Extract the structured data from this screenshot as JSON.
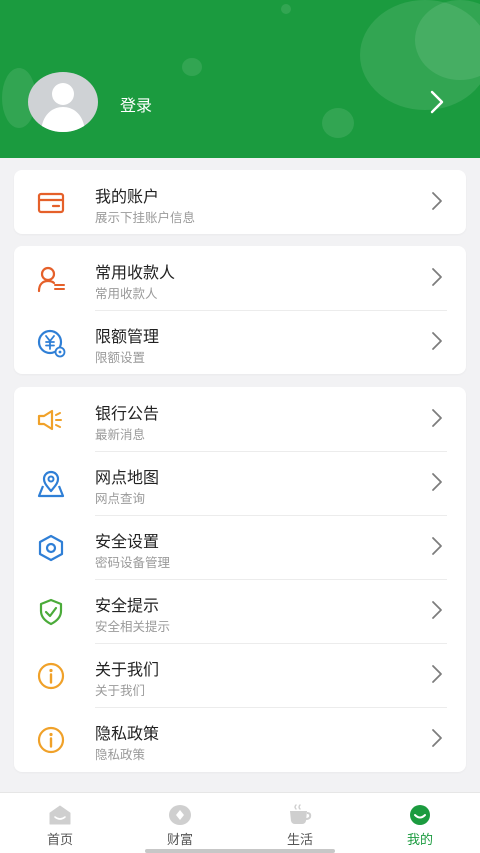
{
  "header": {
    "login_label": "登录",
    "bg_color": "#1b9b3f",
    "icons": {
      "avatar": "default-user-avatar",
      "chevron": "chevron-right-icon"
    }
  },
  "sections": [
    {
      "items": [
        {
          "title": "我的账户",
          "subtitle": "展示下挂账户信息",
          "icon": "card-icon",
          "color": "#e5602a"
        }
      ]
    },
    {
      "items": [
        {
          "title": "常用收款人",
          "subtitle": "常用收款人",
          "icon": "payee-icon",
          "color": "#e5602a"
        },
        {
          "title": "限额管理",
          "subtitle": "限额设置",
          "icon": "yuan-limit-icon",
          "color": "#2f7fd6"
        }
      ]
    },
    {
      "items": [
        {
          "title": "银行公告",
          "subtitle": "最新消息",
          "icon": "megaphone-icon",
          "color": "#f0a129"
        },
        {
          "title": "网点地图",
          "subtitle": "网点查询",
          "icon": "map-pin-icon",
          "color": "#2f7fd6"
        },
        {
          "title": "安全设置",
          "subtitle": "密码设备管理",
          "icon": "hex-gear-icon",
          "color": "#2f7fd6"
        },
        {
          "title": "安全提示",
          "subtitle": "安全相关提示",
          "icon": "shield-check-icon",
          "color": "#4bab3a"
        },
        {
          "title": "关于我们",
          "subtitle": "关于我们",
          "icon": "info-icon",
          "color": "#f0a129"
        },
        {
          "title": "隐私政策",
          "subtitle": "隐私政策",
          "icon": "info-icon",
          "color": "#f0a129"
        }
      ]
    }
  ],
  "tabbar": {
    "tabs": [
      {
        "label": "首页",
        "icon": "home-icon"
      },
      {
        "label": "财富",
        "icon": "wealth-icon"
      },
      {
        "label": "生活",
        "icon": "coffee-cup-icon"
      },
      {
        "label": "我的",
        "icon": "smile-icon"
      }
    ],
    "active_tab": "我的",
    "active_color": "#1b9b3f"
  }
}
